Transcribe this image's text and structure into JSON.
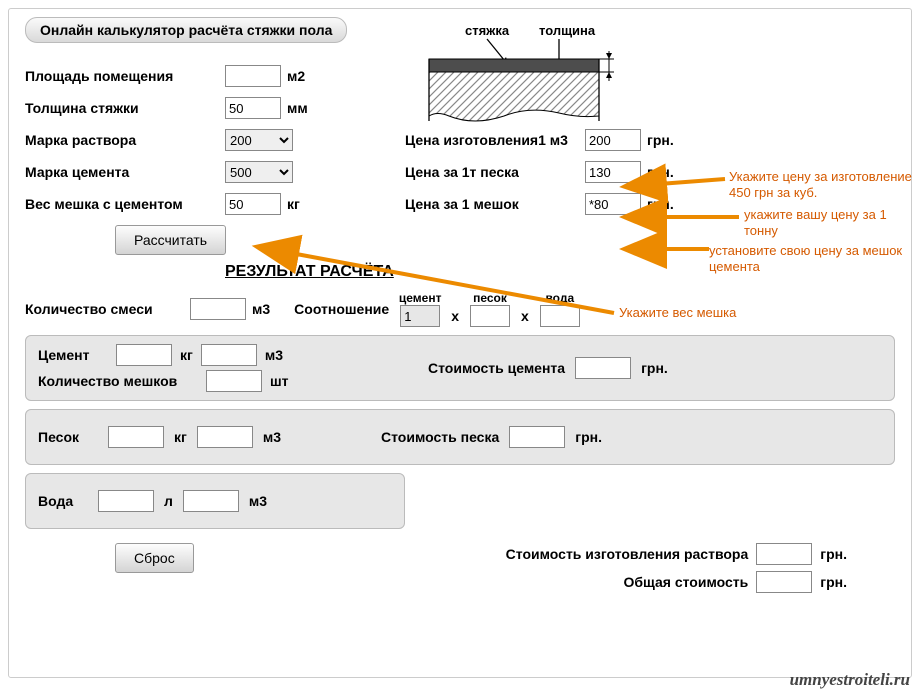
{
  "title": "Онлайн калькулятор расчёта стяжки пола",
  "diagram": {
    "left_label": "стяжка",
    "right_label": "толщина"
  },
  "left_inputs": {
    "area": {
      "label": "Площадь помещения",
      "value": "",
      "unit": "м2"
    },
    "thickness": {
      "label": "Толщина стяжки",
      "value": "50",
      "unit": "мм"
    },
    "mortar_grade": {
      "label": "Марка раствора",
      "value": "200"
    },
    "cement_grade": {
      "label": "Марка цемента",
      "value": "500"
    },
    "bag_weight": {
      "label": "Вес мешка с цементом",
      "value": "50",
      "unit": "кг"
    }
  },
  "right_inputs": {
    "price_m3": {
      "label": "Цена изготовления1 м3",
      "value": "200",
      "unit": "грн."
    },
    "price_sand_t": {
      "label": "Цена за 1т песка",
      "value": "130",
      "unit": "грн."
    },
    "price_bag": {
      "label": "Цена за 1 мешок",
      "value": "*80",
      "unit": "грн."
    }
  },
  "notes": {
    "n1": "Укажите цену за изготовление 450 грн за куб.",
    "n2": "укажите вашу цену за 1 тонну",
    "n3": "установите свою цену за мешок цемента",
    "n4": "Укажите вес мешка"
  },
  "buttons": {
    "calc": "Рассчитать",
    "reset": "Сброс"
  },
  "results": {
    "title": "РЕЗУЛЬТАТ РАСЧЁТА",
    "mix_qty": {
      "label": "Количество смеси",
      "unit": "м3"
    },
    "ratio": {
      "label": "Соотношение",
      "h1": "цемент",
      "h2": "песок",
      "h3": "вода",
      "v1": "1",
      "x": "х"
    },
    "cement": {
      "label": "Цемент",
      "u1": "кг",
      "u2": "м3"
    },
    "bags": {
      "label": "Количество мешков",
      "unit": "шт"
    },
    "cement_cost": {
      "label": "Стоимость цемента",
      "unit": "грн."
    },
    "sand": {
      "label": "Песок",
      "u1": "кг",
      "u2": "м3"
    },
    "sand_cost": {
      "label": "Стоимость песка",
      "unit": "грн."
    },
    "water": {
      "label": "Вода",
      "u1": "л",
      "u2": "м3"
    },
    "mortar_cost": {
      "label": "Стоимость изготовления раствора",
      "unit": "грн."
    },
    "total_cost": {
      "label": "Общая стоимость",
      "unit": "грн."
    }
  },
  "watermark": "umnyestroiteli.ru"
}
